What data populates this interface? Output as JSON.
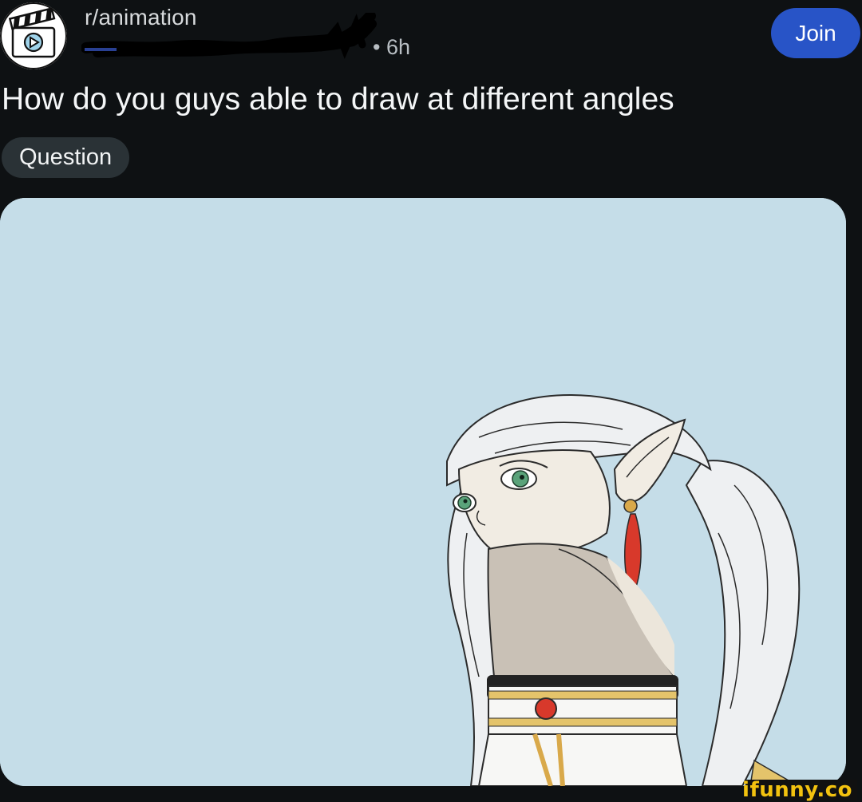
{
  "post": {
    "subreddit": "r/animation",
    "time": "• 6h",
    "title": "How do you guys able to draw at different angles",
    "flair": "Question",
    "join_label": "Join"
  },
  "media": {
    "background_color": "#c5dde8",
    "description_icon": "anime-elf-character-illustration"
  },
  "watermark": {
    "text": "ifunny.co"
  },
  "colors": {
    "page_bg": "#0e1113",
    "join_button": "#2854c7",
    "flair_bg": "#2a3236",
    "watermark": "#f3c20f"
  }
}
